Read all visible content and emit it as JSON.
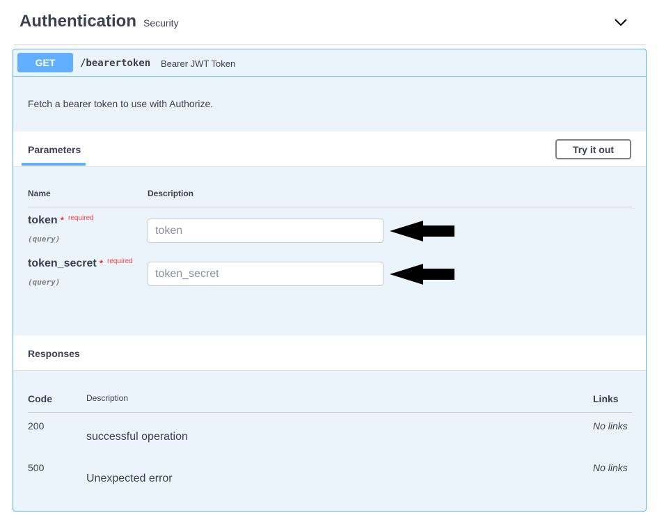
{
  "tag": {
    "title": "Authentication",
    "subtitle": "Security"
  },
  "operation": {
    "method": "GET",
    "path": "/bearertoken",
    "summary": "Bearer JWT Token",
    "description": "Fetch a bearer token to use with Authorize."
  },
  "parameters": {
    "tab_label": "Parameters",
    "try_button_label": "Try it out",
    "col_name": "Name",
    "col_description": "Description",
    "required_text": "required",
    "required_star": "*",
    "items": [
      {
        "name": "token",
        "in": "(query)",
        "placeholder": "token",
        "value": ""
      },
      {
        "name": "token_secret",
        "in": "(query)",
        "placeholder": "token_secret",
        "value": ""
      }
    ]
  },
  "responses": {
    "title": "Responses",
    "col_code": "Code",
    "col_description": "Description",
    "col_links": "Links",
    "items": [
      {
        "code": "200",
        "description": "successful operation",
        "links": "No links"
      },
      {
        "code": "500",
        "description": "Unexpected error",
        "links": "No links"
      }
    ]
  },
  "colors": {
    "get_blue": "#61affe",
    "opblock_bg": "#ebf3fb",
    "text": "#3b4151",
    "required_red": "#f93e3e"
  },
  "icons": {
    "collapse": "chevron-down-icon",
    "pointer": "arrow-left-icon"
  }
}
